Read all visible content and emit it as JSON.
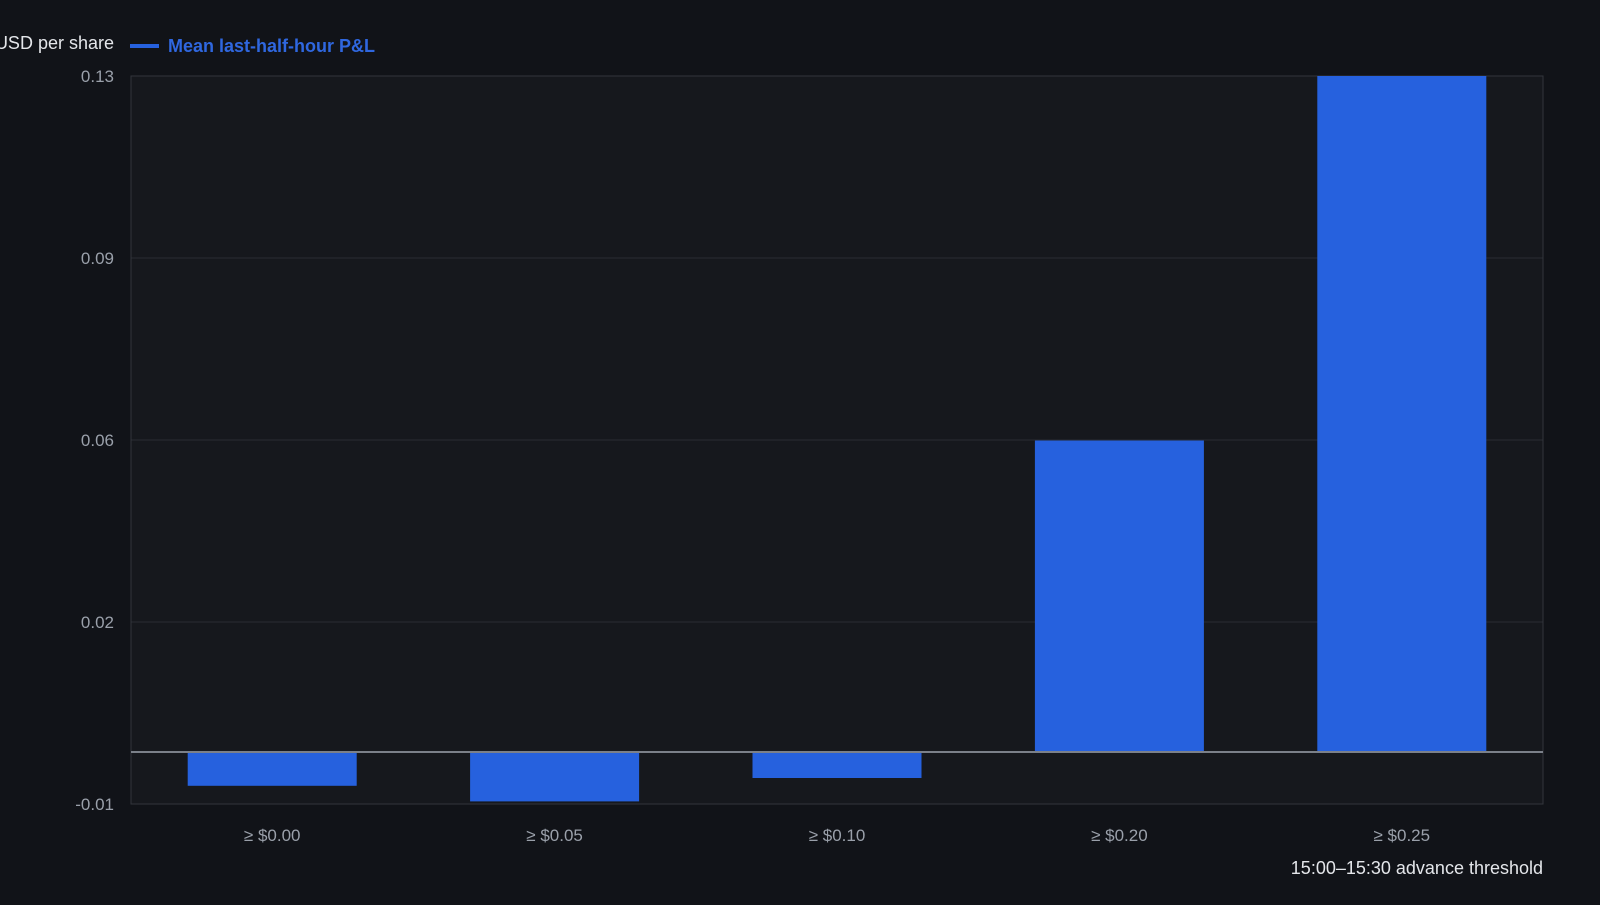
{
  "chart_data": {
    "type": "bar",
    "categories": [
      "≥ $0.00",
      "≥ $0.05",
      "≥ $0.10",
      "≥ $0.20",
      "≥ $0.25"
    ],
    "series": [
      {
        "name": "Mean last-half-hour P&L",
        "values": [
          -0.0065,
          -0.0095,
          -0.005,
          0.0599,
          0.1345
        ]
      }
    ],
    "xlabel": "15:00–15:30 advance threshold",
    "ylabel": "USD per share",
    "ylim": [
      -0.01,
      0.13
    ],
    "yticks": [
      {
        "label": "0.13",
        "value": 0.13
      },
      {
        "label": "0.09",
        "value": 0.095
      },
      {
        "label": "0.06",
        "value": 0.06
      },
      {
        "label": "0.02",
        "value": 0.025
      },
      {
        "label": "-0.01",
        "value": -0.01
      }
    ],
    "grid": true,
    "legend": "top-left",
    "colors": {
      "background": "#111318",
      "plot_background": "#16181d",
      "bar": "#2661de",
      "legend_text": "#2f67df",
      "axis_text": "#9aa0aa",
      "title_text": "#e4e6ea",
      "grid": "#292c33",
      "border": "#32353c",
      "zero_line": "#7b8089"
    }
  }
}
